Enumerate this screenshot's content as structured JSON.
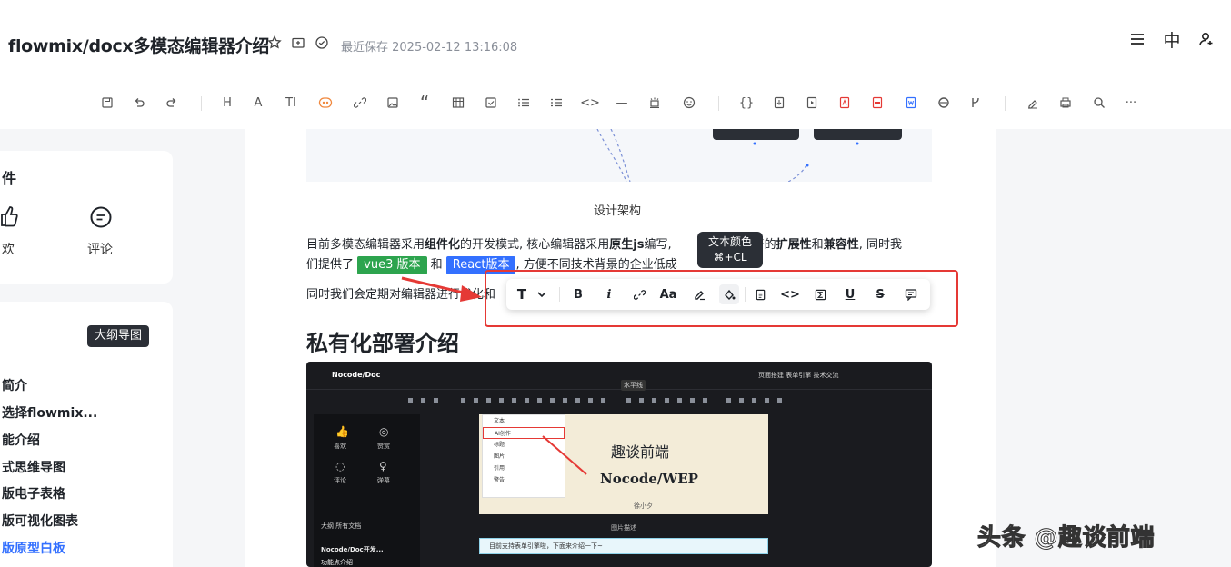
{
  "header": {
    "title": "flowmix/docx多模态编辑器介绍",
    "save_status": "最近保存 2025-02-12 13:16:08",
    "icons": [
      "star-icon",
      "folder-icon",
      "check-circle-icon"
    ],
    "right_icons": [
      "menu-icon",
      "language-icon",
      "add-user-icon"
    ],
    "lang_label": "中"
  },
  "toolbar": {
    "items": [
      "save",
      "undo",
      "redo",
      "heading",
      "font-size",
      "text-style",
      "ai",
      "link",
      "image",
      "quote",
      "table",
      "checkbox",
      "ordered-list",
      "bullet-list",
      "code",
      "divider",
      "highlight",
      "emoji",
      "code-block",
      "import",
      "export",
      "pdf",
      "ppt",
      "word",
      "html",
      "branch",
      "sign",
      "print",
      "search",
      "more"
    ],
    "labels": {
      "heading": "H",
      "font_size": "A",
      "text_style": "TI",
      "quote": "“",
      "code": "<>",
      "divider": "—",
      "more": "···",
      "code_block": "{}"
    }
  },
  "left_panel": {
    "card_title": "件",
    "like_label": "欢",
    "comment_label": "评论",
    "outline_button": "大纲导图",
    "outline_items": [
      "简介",
      "选择flowmix...",
      "能介绍",
      "式思维导图",
      "版电子表格",
      "版可视化图表",
      "版原型白板"
    ],
    "active_item": "版原型白板"
  },
  "doc": {
    "figure_caption": "设计架构",
    "para1_a": "目前多模态编辑器采用",
    "para1_b": "组件化",
    "para1_c": "的开发模式, 核心编辑器采用",
    "para1_d": "原生js",
    "para1_e": "编写,",
    "para1_f": "更好的",
    "para1_g": "扩展性",
    "para1_h": "和",
    "para1_i": "兼容性",
    "para1_j": ", 同时我",
    "para2_a": "们提供了",
    "tag_vue": "vue3 版本",
    "para2_b": "和",
    "tag_react": "React版本",
    "para2_c": ", 方便不同技术背景的企业低成",
    "para3": "同时我们会定期对编辑器进行优化和",
    "heading2": "私有化部署介绍"
  },
  "tooltip": {
    "title": "文本颜色",
    "shortcut": "⌘+CL"
  },
  "float_toolbar": {
    "items": [
      "text-type",
      "bold",
      "italic",
      "link",
      "font-size",
      "highlight",
      "text-color",
      "doc",
      "code",
      "formula",
      "underline",
      "strikethrough",
      "comment"
    ],
    "labels": {
      "text_type": "T",
      "bold": "B",
      "italic": "i",
      "font_size": "Aa",
      "code": "<>",
      "underline": "U",
      "strike": "S"
    }
  },
  "screenshot": {
    "logo": "Nocode/Doc",
    "nav": "页面搭建    表单引擎    技术交流",
    "card_title": "趣谈前端",
    "card_subtitle": "Nocode/WEP",
    "card_author": "徐小夕",
    "menu_items": [
      "文本",
      "AI创作",
      "标题",
      "图片",
      "引用",
      "警告"
    ],
    "caption": "图片描述",
    "input_text": "目前支持表单引擎啦，下面来介绍一下~",
    "sidebar_tabs": "大纲    所有文档",
    "sidebar_item1": "Nocode/Doc开发...",
    "sidebar_item2": "功能点介绍",
    "tooltip": "水平线",
    "side_labels": [
      "喜欢",
      "赞赏",
      "评论",
      "弹幕"
    ]
  },
  "watermark": "头条 @趣谈前端",
  "colors": {
    "accent_blue": "#3370ff",
    "tag_green": "#2da44e",
    "red_highlight": "#e53935",
    "dark": "#2b2f36"
  }
}
